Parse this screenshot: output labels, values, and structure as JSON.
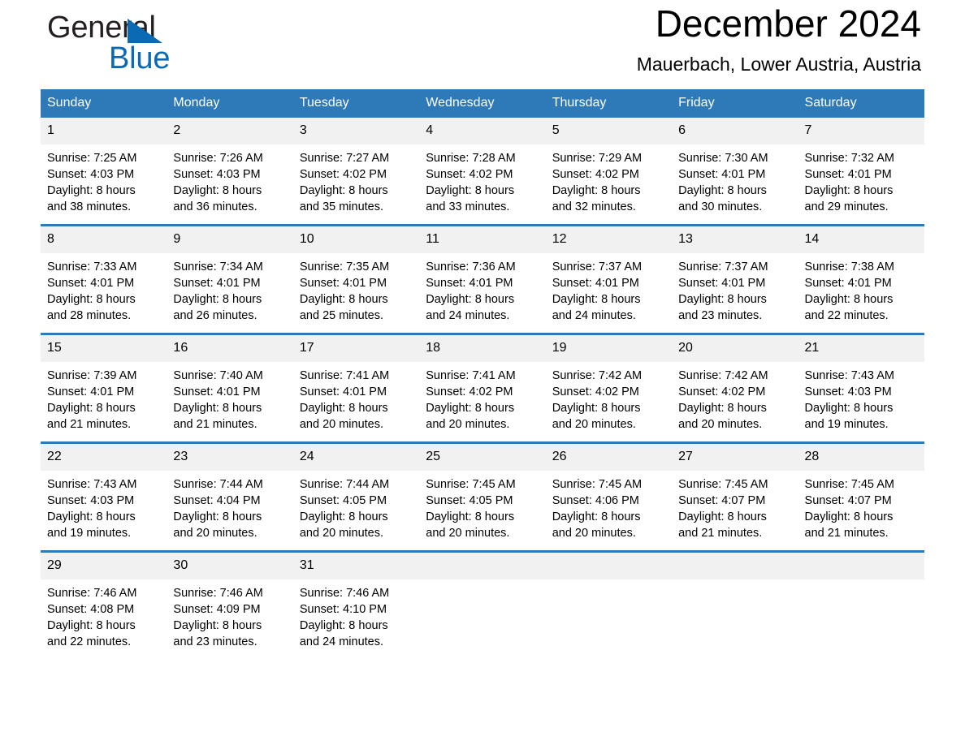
{
  "brand": {
    "name_part1": "General",
    "name_part2": "Blue",
    "mark": "triangle-logo",
    "accent_color": "#0a6ab4"
  },
  "header": {
    "title": "December 2024",
    "location": "Mauerbach, Lower Austria, Austria"
  },
  "theme": {
    "header_blue": "#2e7ab8",
    "daynum_band": "#f1f1f1",
    "text": "#000000"
  },
  "weekday_headers": [
    "Sunday",
    "Monday",
    "Tuesday",
    "Wednesday",
    "Thursday",
    "Friday",
    "Saturday"
  ],
  "weeks": [
    {
      "days": [
        {
          "num": "1",
          "sunrise": "Sunrise: 7:25 AM",
          "sunset": "Sunset: 4:03 PM",
          "daylight_line1": "Daylight: 8 hours",
          "daylight_line2": "and 38 minutes."
        },
        {
          "num": "2",
          "sunrise": "Sunrise: 7:26 AM",
          "sunset": "Sunset: 4:03 PM",
          "daylight_line1": "Daylight: 8 hours",
          "daylight_line2": "and 36 minutes."
        },
        {
          "num": "3",
          "sunrise": "Sunrise: 7:27 AM",
          "sunset": "Sunset: 4:02 PM",
          "daylight_line1": "Daylight: 8 hours",
          "daylight_line2": "and 35 minutes."
        },
        {
          "num": "4",
          "sunrise": "Sunrise: 7:28 AM",
          "sunset": "Sunset: 4:02 PM",
          "daylight_line1": "Daylight: 8 hours",
          "daylight_line2": "and 33 minutes."
        },
        {
          "num": "5",
          "sunrise": "Sunrise: 7:29 AM",
          "sunset": "Sunset: 4:02 PM",
          "daylight_line1": "Daylight: 8 hours",
          "daylight_line2": "and 32 minutes."
        },
        {
          "num": "6",
          "sunrise": "Sunrise: 7:30 AM",
          "sunset": "Sunset: 4:01 PM",
          "daylight_line1": "Daylight: 8 hours",
          "daylight_line2": "and 30 minutes."
        },
        {
          "num": "7",
          "sunrise": "Sunrise: 7:32 AM",
          "sunset": "Sunset: 4:01 PM",
          "daylight_line1": "Daylight: 8 hours",
          "daylight_line2": "and 29 minutes."
        }
      ]
    },
    {
      "days": [
        {
          "num": "8",
          "sunrise": "Sunrise: 7:33 AM",
          "sunset": "Sunset: 4:01 PM",
          "daylight_line1": "Daylight: 8 hours",
          "daylight_line2": "and 28 minutes."
        },
        {
          "num": "9",
          "sunrise": "Sunrise: 7:34 AM",
          "sunset": "Sunset: 4:01 PM",
          "daylight_line1": "Daylight: 8 hours",
          "daylight_line2": "and 26 minutes."
        },
        {
          "num": "10",
          "sunrise": "Sunrise: 7:35 AM",
          "sunset": "Sunset: 4:01 PM",
          "daylight_line1": "Daylight: 8 hours",
          "daylight_line2": "and 25 minutes."
        },
        {
          "num": "11",
          "sunrise": "Sunrise: 7:36 AM",
          "sunset": "Sunset: 4:01 PM",
          "daylight_line1": "Daylight: 8 hours",
          "daylight_line2": "and 24 minutes."
        },
        {
          "num": "12",
          "sunrise": "Sunrise: 7:37 AM",
          "sunset": "Sunset: 4:01 PM",
          "daylight_line1": "Daylight: 8 hours",
          "daylight_line2": "and 24 minutes."
        },
        {
          "num": "13",
          "sunrise": "Sunrise: 7:37 AM",
          "sunset": "Sunset: 4:01 PM",
          "daylight_line1": "Daylight: 8 hours",
          "daylight_line2": "and 23 minutes."
        },
        {
          "num": "14",
          "sunrise": "Sunrise: 7:38 AM",
          "sunset": "Sunset: 4:01 PM",
          "daylight_line1": "Daylight: 8 hours",
          "daylight_line2": "and 22 minutes."
        }
      ]
    },
    {
      "days": [
        {
          "num": "15",
          "sunrise": "Sunrise: 7:39 AM",
          "sunset": "Sunset: 4:01 PM",
          "daylight_line1": "Daylight: 8 hours",
          "daylight_line2": "and 21 minutes."
        },
        {
          "num": "16",
          "sunrise": "Sunrise: 7:40 AM",
          "sunset": "Sunset: 4:01 PM",
          "daylight_line1": "Daylight: 8 hours",
          "daylight_line2": "and 21 minutes."
        },
        {
          "num": "17",
          "sunrise": "Sunrise: 7:41 AM",
          "sunset": "Sunset: 4:01 PM",
          "daylight_line1": "Daylight: 8 hours",
          "daylight_line2": "and 20 minutes."
        },
        {
          "num": "18",
          "sunrise": "Sunrise: 7:41 AM",
          "sunset": "Sunset: 4:02 PM",
          "daylight_line1": "Daylight: 8 hours",
          "daylight_line2": "and 20 minutes."
        },
        {
          "num": "19",
          "sunrise": "Sunrise: 7:42 AM",
          "sunset": "Sunset: 4:02 PM",
          "daylight_line1": "Daylight: 8 hours",
          "daylight_line2": "and 20 minutes."
        },
        {
          "num": "20",
          "sunrise": "Sunrise: 7:42 AM",
          "sunset": "Sunset: 4:02 PM",
          "daylight_line1": "Daylight: 8 hours",
          "daylight_line2": "and 20 minutes."
        },
        {
          "num": "21",
          "sunrise": "Sunrise: 7:43 AM",
          "sunset": "Sunset: 4:03 PM",
          "daylight_line1": "Daylight: 8 hours",
          "daylight_line2": "and 19 minutes."
        }
      ]
    },
    {
      "days": [
        {
          "num": "22",
          "sunrise": "Sunrise: 7:43 AM",
          "sunset": "Sunset: 4:03 PM",
          "daylight_line1": "Daylight: 8 hours",
          "daylight_line2": "and 19 minutes."
        },
        {
          "num": "23",
          "sunrise": "Sunrise: 7:44 AM",
          "sunset": "Sunset: 4:04 PM",
          "daylight_line1": "Daylight: 8 hours",
          "daylight_line2": "and 20 minutes."
        },
        {
          "num": "24",
          "sunrise": "Sunrise: 7:44 AM",
          "sunset": "Sunset: 4:05 PM",
          "daylight_line1": "Daylight: 8 hours",
          "daylight_line2": "and 20 minutes."
        },
        {
          "num": "25",
          "sunrise": "Sunrise: 7:45 AM",
          "sunset": "Sunset: 4:05 PM",
          "daylight_line1": "Daylight: 8 hours",
          "daylight_line2": "and 20 minutes."
        },
        {
          "num": "26",
          "sunrise": "Sunrise: 7:45 AM",
          "sunset": "Sunset: 4:06 PM",
          "daylight_line1": "Daylight: 8 hours",
          "daylight_line2": "and 20 minutes."
        },
        {
          "num": "27",
          "sunrise": "Sunrise: 7:45 AM",
          "sunset": "Sunset: 4:07 PM",
          "daylight_line1": "Daylight: 8 hours",
          "daylight_line2": "and 21 minutes."
        },
        {
          "num": "28",
          "sunrise": "Sunrise: 7:45 AM",
          "sunset": "Sunset: 4:07 PM",
          "daylight_line1": "Daylight: 8 hours",
          "daylight_line2": "and 21 minutes."
        }
      ]
    },
    {
      "days": [
        {
          "num": "29",
          "sunrise": "Sunrise: 7:46 AM",
          "sunset": "Sunset: 4:08 PM",
          "daylight_line1": "Daylight: 8 hours",
          "daylight_line2": "and 22 minutes."
        },
        {
          "num": "30",
          "sunrise": "Sunrise: 7:46 AM",
          "sunset": "Sunset: 4:09 PM",
          "daylight_line1": "Daylight: 8 hours",
          "daylight_line2": "and 23 minutes."
        },
        {
          "num": "31",
          "sunrise": "Sunrise: 7:46 AM",
          "sunset": "Sunset: 4:10 PM",
          "daylight_line1": "Daylight: 8 hours",
          "daylight_line2": "and 24 minutes."
        },
        {
          "num": "",
          "sunrise": "",
          "sunset": "",
          "daylight_line1": "",
          "daylight_line2": ""
        },
        {
          "num": "",
          "sunrise": "",
          "sunset": "",
          "daylight_line1": "",
          "daylight_line2": ""
        },
        {
          "num": "",
          "sunrise": "",
          "sunset": "",
          "daylight_line1": "",
          "daylight_line2": ""
        },
        {
          "num": "",
          "sunrise": "",
          "sunset": "",
          "daylight_line1": "",
          "daylight_line2": ""
        }
      ]
    }
  ]
}
